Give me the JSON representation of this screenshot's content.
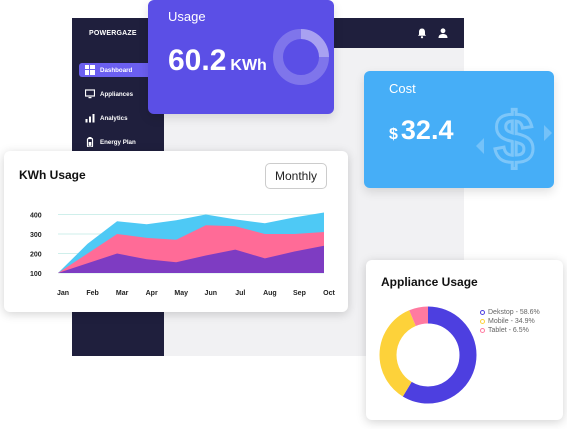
{
  "app": {
    "logo": "POWERGAZE",
    "nav": [
      {
        "label": "Dashboard",
        "icon": "dashboard-icon",
        "active": true
      },
      {
        "label": "Appliances",
        "icon": "monitor-icon",
        "active": false
      },
      {
        "label": "Analytics",
        "icon": "bar-chart-icon",
        "active": false
      },
      {
        "label": "Energy Plan",
        "icon": "battery-icon",
        "active": false
      }
    ],
    "topbar_icons": [
      "bell-icon",
      "user-icon"
    ]
  },
  "usage": {
    "title": "Usage",
    "value": "60.2",
    "unit": "KWh",
    "color": "#5b4fe6"
  },
  "cost": {
    "title": "Cost",
    "currency": "$",
    "value": "32.4",
    "color": "#46aef7"
  },
  "kwh_card": {
    "title": "KWh  Usage",
    "period": "Monthly"
  },
  "appliance_card": {
    "title": "Appliance Usage"
  },
  "chart_data": [
    {
      "type": "area",
      "title": "KWh  Usage",
      "categories": [
        "Jan",
        "Feb",
        "Mar",
        "Apr",
        "May",
        "Jun",
        "Jul",
        "Aug",
        "Sep",
        "Oct"
      ],
      "yticks": [
        100,
        200,
        300,
        400
      ],
      "ylim": [
        100,
        400
      ],
      "series": [
        {
          "color": "#4ec9f5",
          "values": [
            100,
            250,
            365,
            350,
            370,
            400,
            375,
            355,
            385,
            410
          ]
        },
        {
          "color": "#ff6b97",
          "values": [
            100,
            200,
            300,
            280,
            270,
            345,
            340,
            300,
            300,
            310
          ]
        },
        {
          "color": "#7e3cc2",
          "values": [
            100,
            150,
            200,
            170,
            155,
            190,
            220,
            175,
            210,
            240
          ]
        }
      ],
      "grid": "horizontal-teal"
    },
    {
      "type": "pie",
      "title": "Appliance Usage",
      "slices": [
        {
          "label": "Dekstop - 58.6%",
          "value": 58.6,
          "color": "#4d3fe0"
        },
        {
          "label": "Mobile - 34.9%",
          "value": 34.9,
          "color": "#fdd23a"
        },
        {
          "label": "Tablet - 6.5%",
          "value": 6.5,
          "color": "#ff7aa0"
        }
      ]
    }
  ]
}
